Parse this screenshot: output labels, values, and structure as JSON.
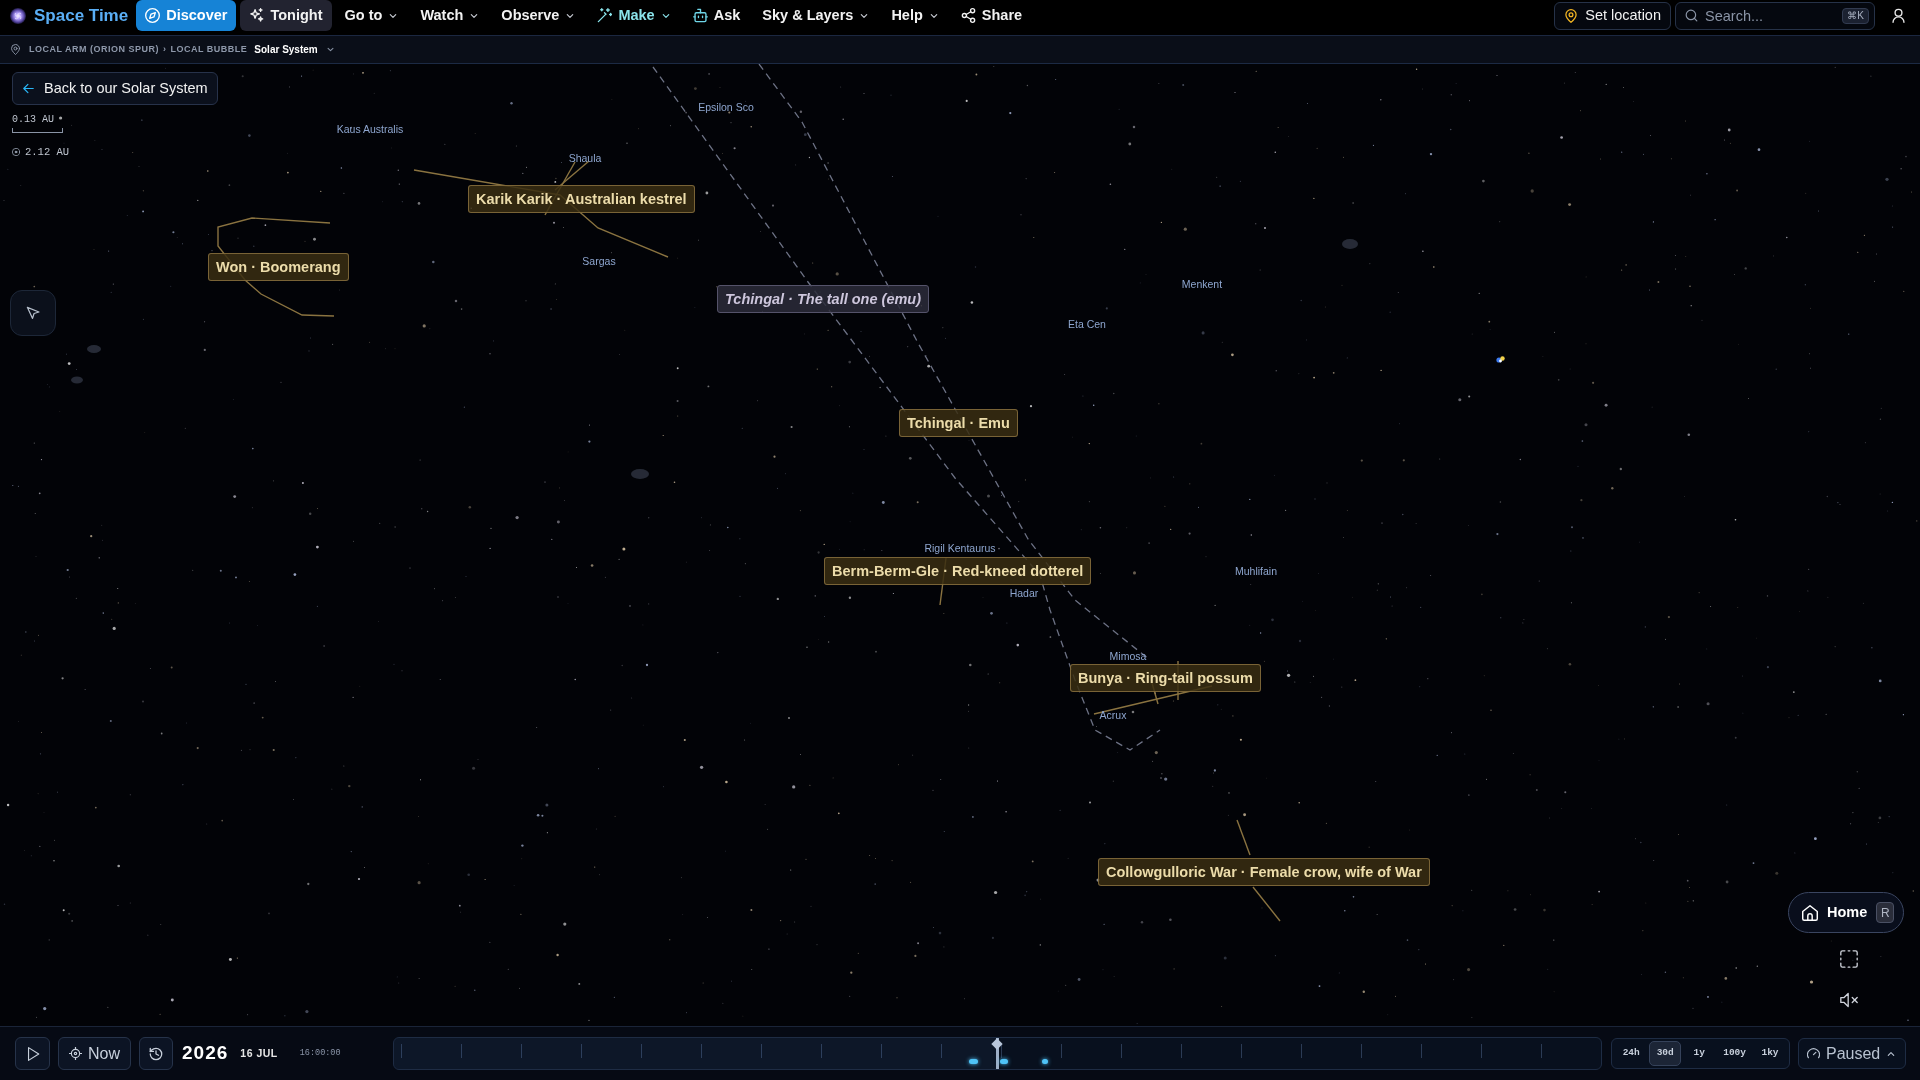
{
  "app": {
    "title": "Space Time"
  },
  "nav": [
    {
      "label": "Discover",
      "kind": "button",
      "selected": true
    },
    {
      "label": "Tonight",
      "kind": "button",
      "selected": false
    },
    {
      "label": "Go to",
      "kind": "menu",
      "selected": false
    },
    {
      "label": "Watch",
      "kind": "menu",
      "selected": false
    },
    {
      "label": "Observe",
      "kind": "menu",
      "selected": false
    },
    {
      "label": "Make",
      "kind": "featured",
      "selected": false
    },
    {
      "label": "Ask",
      "kind": "link",
      "selected": false
    },
    {
      "label": "Sky & Layers",
      "kind": "menu",
      "selected": false
    },
    {
      "label": "Help",
      "kind": "menu",
      "selected": false
    },
    {
      "label": "Share",
      "kind": "link",
      "selected": false
    }
  ],
  "toolbar": {
    "location_button": "Set location",
    "search": {
      "placeholder": "Search...",
      "shortcut": "⌘K"
    }
  },
  "breadcrumb": [
    {
      "label": "LOCAL ARM (ORION SPUR)",
      "kind": "ancestor"
    },
    {
      "label": "›",
      "kind": "separator"
    },
    {
      "label": "LOCAL BUBBLE",
      "kind": "ancestor"
    },
    {
      "label": "Solar System",
      "kind": "current"
    }
  ],
  "back_button": "Back to our Solar System",
  "scale": {
    "bar_label": "0.13 AU",
    "sun_distance": "2.12 AU"
  },
  "sky": {
    "star_labels": [
      {
        "name": "Epsilon Sco"
      },
      {
        "name": "Kaus Australis"
      },
      {
        "name": "Shaula"
      },
      {
        "name": "Sargas"
      },
      {
        "name": "Menkent"
      },
      {
        "name": "Eta Cen"
      },
      {
        "name": "Rigil Kentaurus"
      },
      {
        "name": "Muhlifain"
      },
      {
        "name": "Hadar"
      },
      {
        "name": "Mimosa"
      },
      {
        "name": "Acrux"
      }
    ],
    "constellations": [
      {
        "label": "Karik Karik · Australian kestrel",
        "kind": "figure"
      },
      {
        "label": "Won · Boomerang",
        "kind": "figure"
      },
      {
        "label": "Tchingal · The tall one (emu)",
        "kind": "dark"
      },
      {
        "label": "Tchingal · Emu",
        "kind": "figure"
      },
      {
        "label": "Berm-Berm-Gle · Red-kneed dotterel",
        "kind": "figure"
      },
      {
        "label": "Bunya · Ring-tail possum",
        "kind": "figure"
      },
      {
        "label": "Collowgulloric War · Female crow, wife of War",
        "kind": "figure"
      }
    ]
  },
  "home_button": {
    "label": "Home",
    "shortcut": "R"
  },
  "sound": {
    "muted": true
  },
  "timeline": {
    "playing": false,
    "now_button": "Now",
    "year": "2026",
    "date": "16 JUL",
    "time": "16:00:00",
    "level": 0.5,
    "ranges": [
      {
        "label": "24h",
        "selected": false
      },
      {
        "label": "30d",
        "selected": true
      },
      {
        "label": "1y",
        "selected": false
      },
      {
        "label": "100y",
        "selected": false
      },
      {
        "label": "1ky",
        "selected": false
      }
    ],
    "speed": "Paused"
  }
}
